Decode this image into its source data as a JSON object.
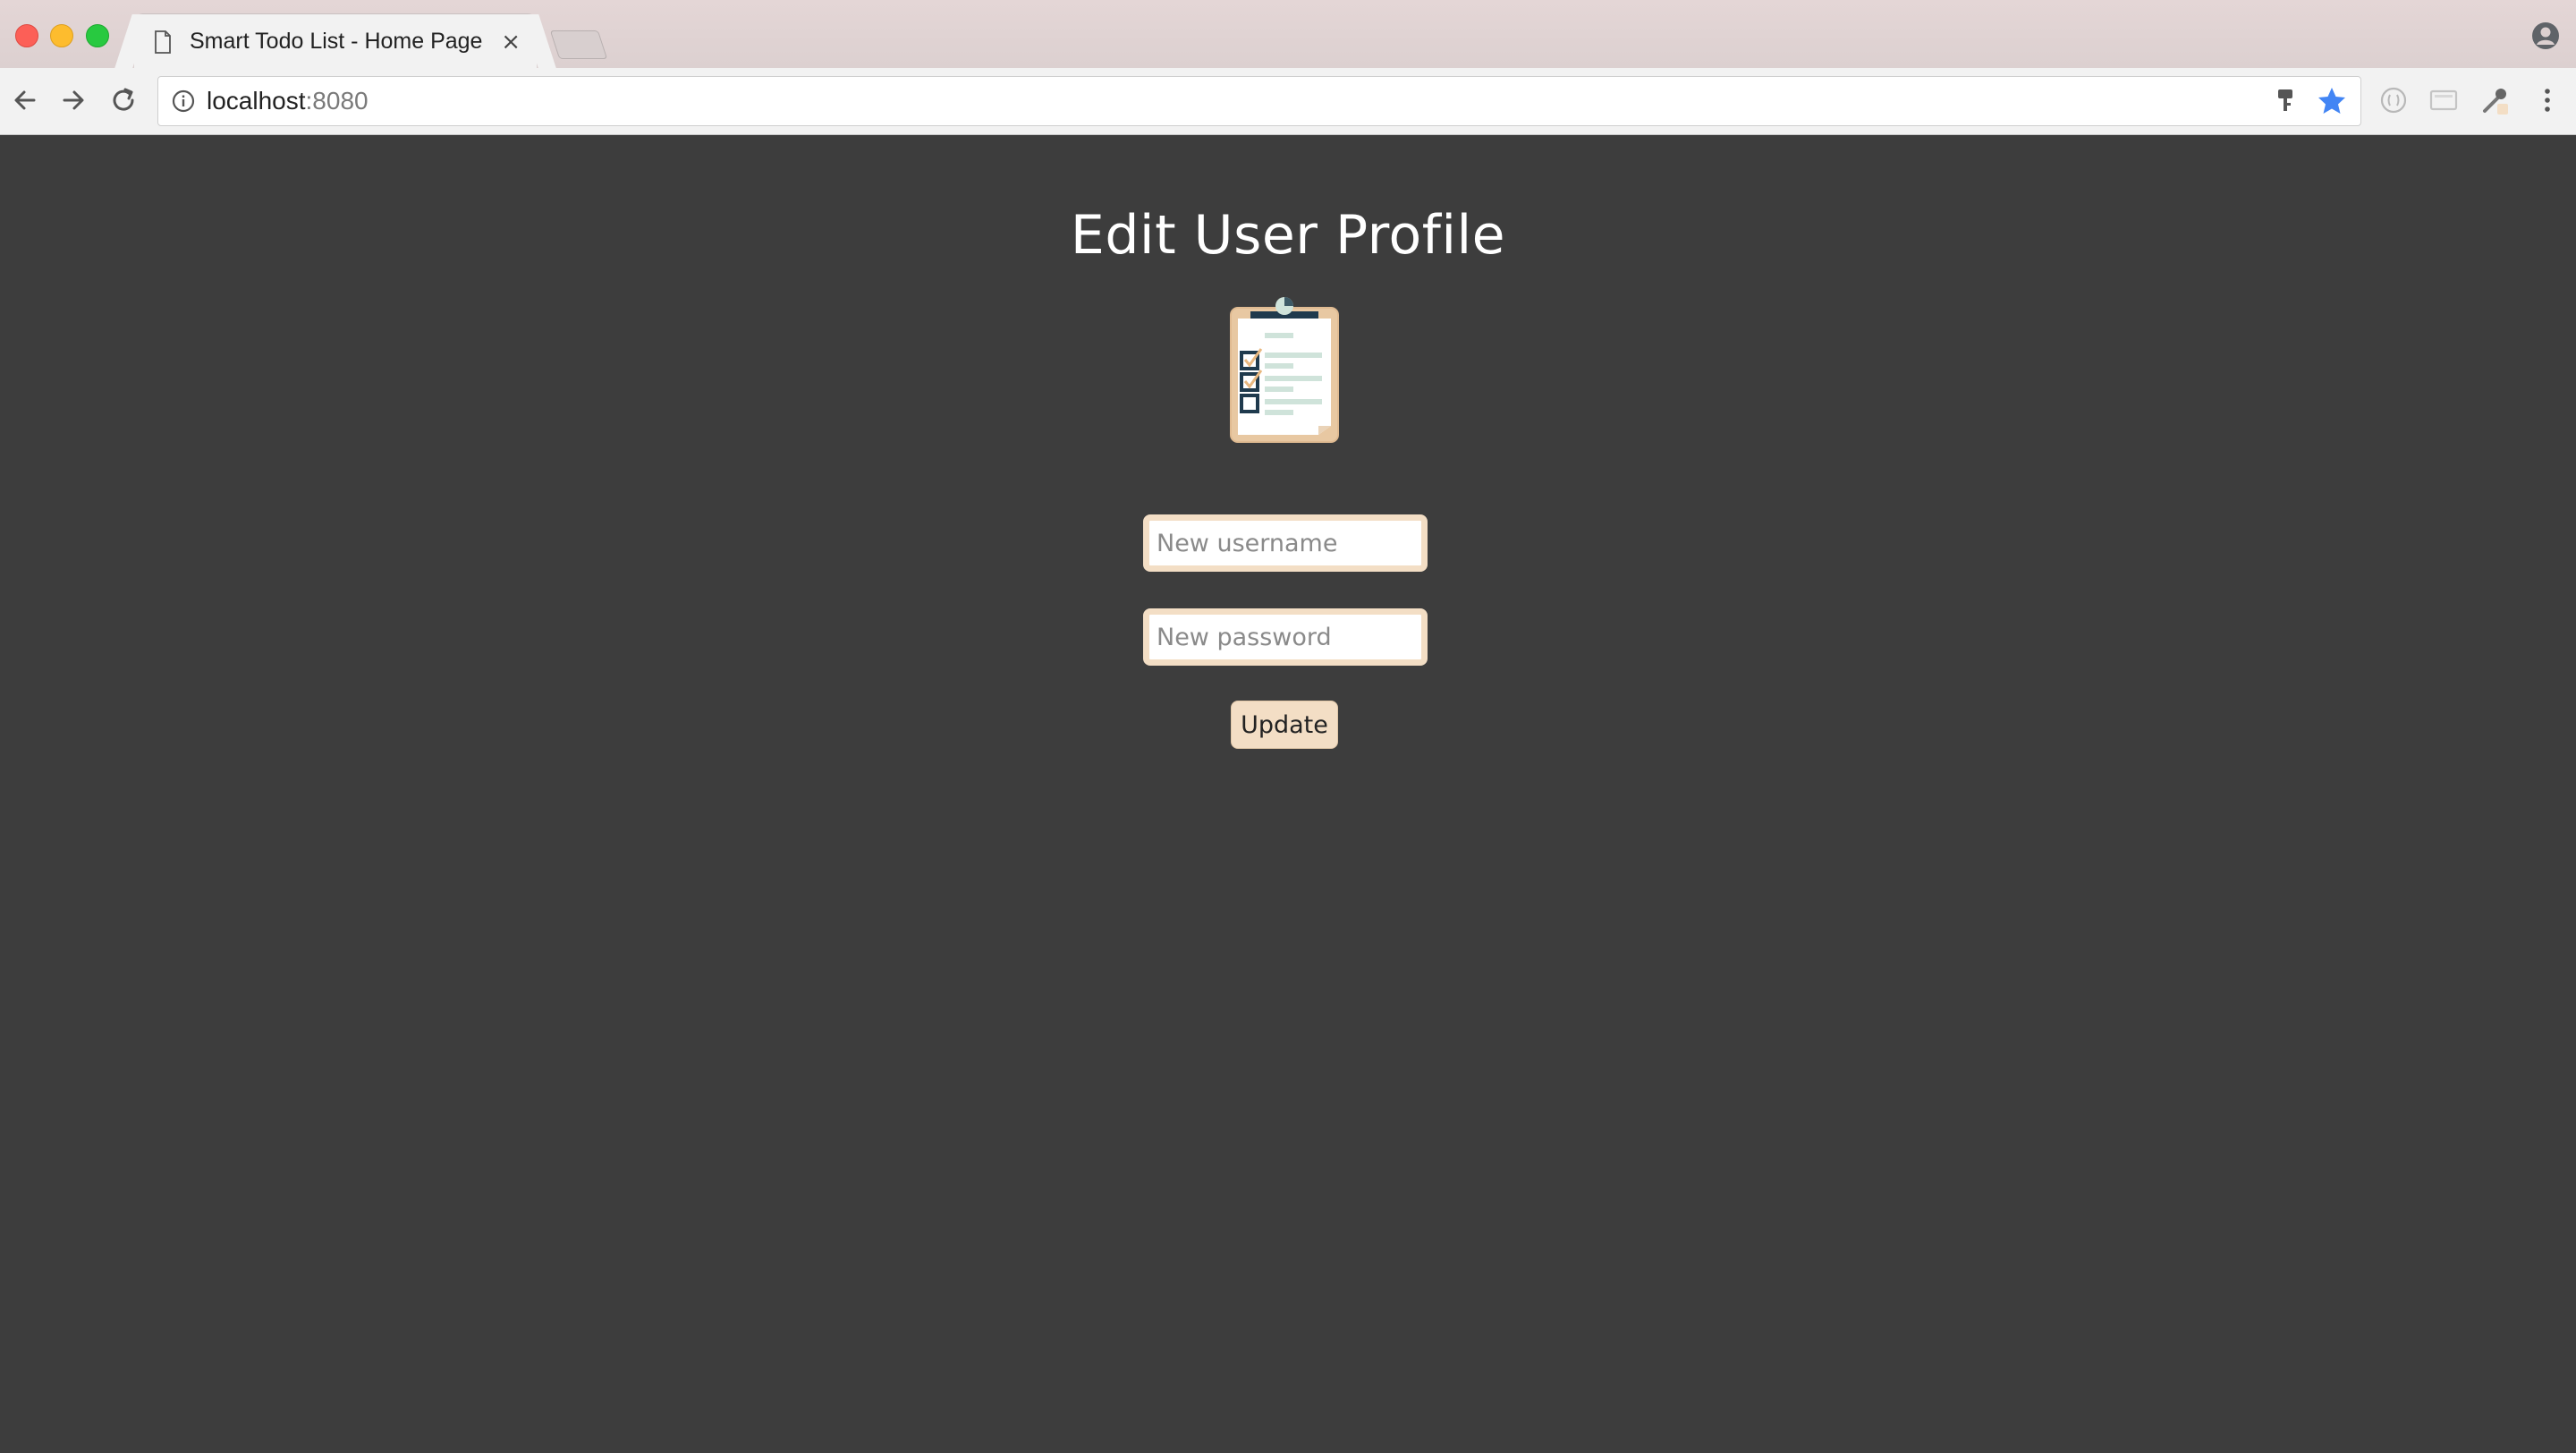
{
  "browser": {
    "tab": {
      "title": "Smart Todo List - Home Page",
      "close_glyph": "×"
    },
    "url": {
      "host": "localhost",
      "port": ":8080"
    },
    "icons": {
      "back": "back-arrow-icon",
      "forward": "forward-arrow-icon",
      "reload": "reload-icon",
      "info": "info-icon",
      "key": "key-icon",
      "bookmark": "star-icon",
      "profile": "profile-icon",
      "menu": "kebab-menu-icon"
    },
    "colors": {
      "bookmark_star": "#4285f4"
    }
  },
  "page": {
    "title": "Edit User Profile",
    "logo_icon": "clipboard-checklist-icon",
    "username_placeholder": "New username",
    "password_placeholder": "New password",
    "submit_label": "Update",
    "colors": {
      "background": "#3d3d3d",
      "accent": "#f3dec5",
      "title": "#ffffff"
    }
  }
}
